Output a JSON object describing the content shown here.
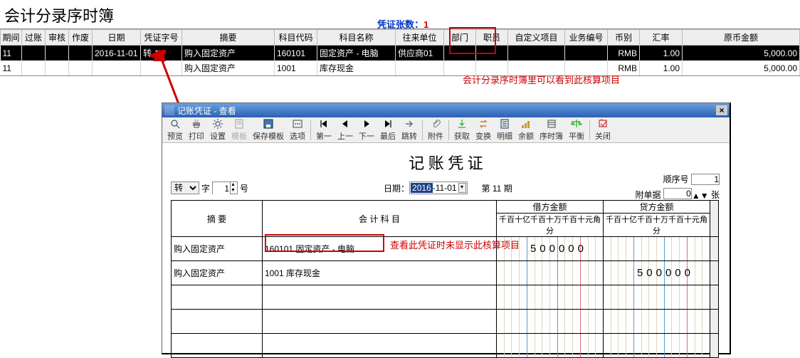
{
  "page_title": "会计分录序时簿",
  "voucher_count_label": "凭证张数：",
  "voucher_count": "1",
  "grid": {
    "columns": [
      "期间",
      "过账",
      "审核",
      "作废",
      "日期",
      "凭证字号",
      "摘要",
      "科目代码",
      "科目名称",
      "往来单位",
      "部门",
      "职员",
      "自定义项目",
      "业务编号",
      "币别",
      "汇率",
      "原币金额"
    ],
    "rows": [
      {
        "period": "11",
        "post": "",
        "audit": "",
        "void": "",
        "date": "2016-11-01",
        "vno": "转-1",
        "summary": "购入固定资产",
        "acct_code": "160101",
        "acct_name": "固定资产 - 电脑",
        "vendor": "供应商01",
        "dept": "",
        "emp": "",
        "custom": "",
        "biz": "",
        "ccy": "RMB",
        "rate": "1.00",
        "amt": "5,000.00",
        "selected": true
      },
      {
        "period": "11",
        "post": "",
        "audit": "",
        "void": "",
        "date": "",
        "vno": "",
        "summary": "购入固定资产",
        "acct_code": "1001",
        "acct_name": "库存现金",
        "vendor": "",
        "dept": "",
        "emp": "",
        "custom": "",
        "biz": "",
        "ccy": "RMB",
        "rate": "1.00",
        "amt": "5,000.00",
        "selected": false
      }
    ]
  },
  "note1": "会计分录序时簿里可以看到此核算项目",
  "voucher_window": {
    "title": "记账凭证 - 查看",
    "toolbar": [
      "预览",
      "打印",
      "设置",
      "模板",
      "保存模板",
      "选项",
      "第一",
      "上一",
      "下一",
      "最后",
      "跳转",
      "附件",
      "获取",
      "变换",
      "明细",
      "余额",
      "序时簿",
      "平衡",
      "关闭"
    ],
    "big_title": "记 账 凭 证",
    "zi_options": [
      "转"
    ],
    "zi_selected": "转",
    "zi_label": "字",
    "hao_value": "1",
    "hao_label": "号",
    "date_label": "日期：",
    "date_year": "2016",
    "date_rest": "-11-01",
    "period_label_prefix": "第 ",
    "period_value": "11",
    "period_label_suffix": " 期",
    "seq_label": "顺序号",
    "seq_value": "1",
    "attach_label": "附单据",
    "attach_value": "0",
    "attach_suffix": "张",
    "table": {
      "head_summary": "摘  要",
      "head_account": "会 计 科 目",
      "head_debit": "借方金额",
      "head_credit": "贷方金额",
      "digit_heads": "千百十亿千百十万千百十元角分",
      "rows": [
        {
          "summary": "购入固定资产",
          "account": "160101 固定资产 - 电脑",
          "debit": "500000",
          "credit": "",
          "highlight_account": true
        },
        {
          "summary": "购入固定资产",
          "account": "1001 库存现金",
          "debit": "",
          "credit": "500000"
        },
        {
          "summary": "",
          "account": "",
          "debit": "",
          "credit": ""
        },
        {
          "summary": "",
          "account": "",
          "debit": "",
          "credit": ""
        },
        {
          "summary": "",
          "account": "",
          "debit": "",
          "credit": ""
        }
      ],
      "note": "查看此凭证时未显示此核算项目"
    }
  }
}
